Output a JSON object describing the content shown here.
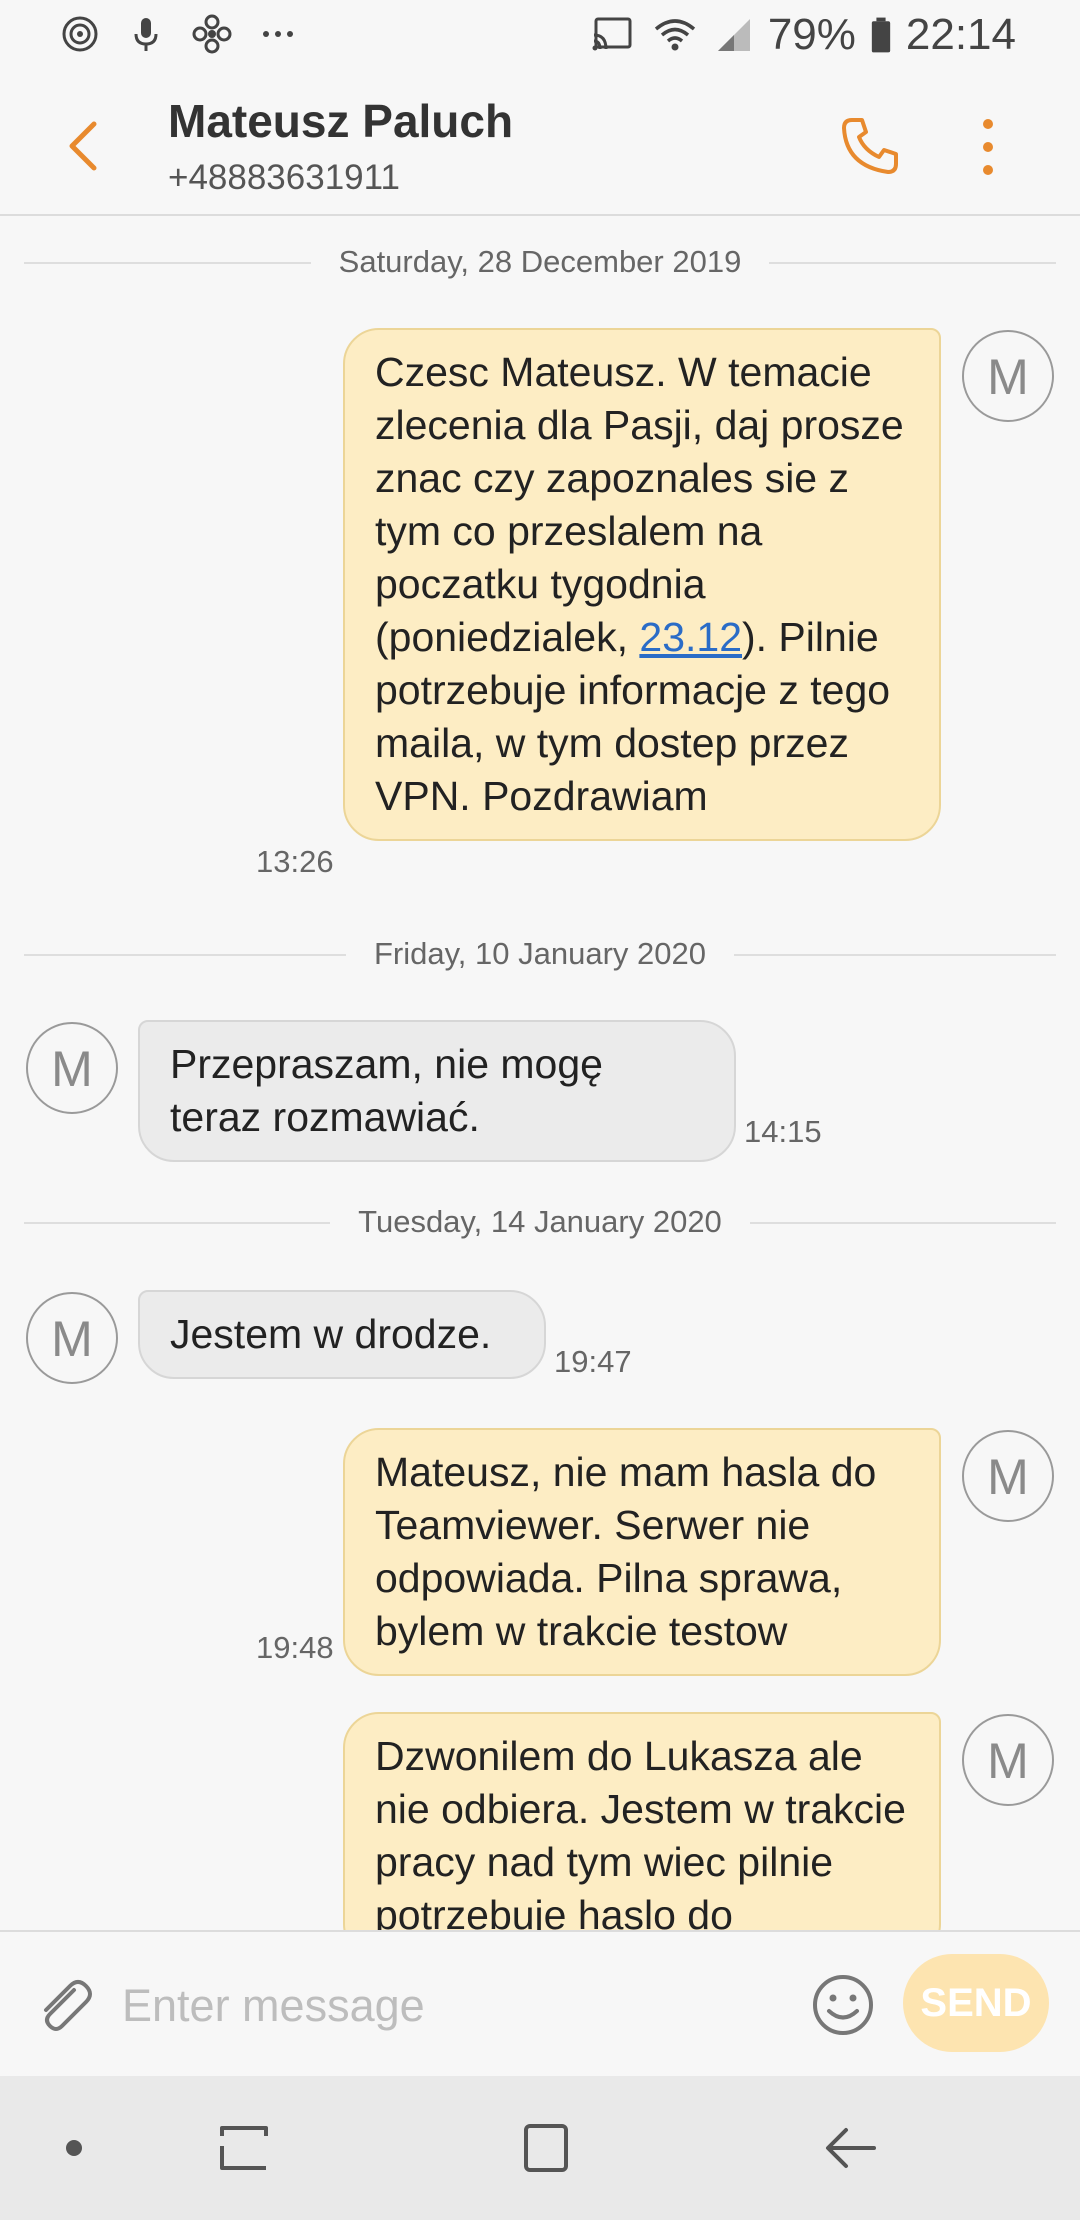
{
  "status_bar": {
    "battery": "79%",
    "time": "22:14",
    "left_icons": [
      "target-icon",
      "mic-icon",
      "fan-icon",
      "more-dots-icon"
    ],
    "right_icons": [
      "cast-icon",
      "wifi-icon",
      "signal-icon",
      "battery-icon"
    ]
  },
  "header": {
    "contact_name": "Mateusz Paluch",
    "contact_number": "+48883631911",
    "accent_color": "#e88a2e"
  },
  "conversation": {
    "dates": [
      "Saturday, 28 December 2019",
      "Friday, 10 January 2020",
      "Tuesday, 14 January 2020"
    ],
    "messages": [
      {
        "direction": "outgoing",
        "text_before_link": "Czesc Mateusz. W temacie zlecenia dla Pasji, daj prosze znac czy zapoznales sie z tym co przeslalem na poczatku tygodnia (poniedzialek, ",
        "link": "23.12",
        "text_after_link": "). Pilnie potrzebuje informacje z tego maila, w tym dostep przez VPN. Pozdrawiam",
        "time": "13:26",
        "avatar": "M"
      },
      {
        "direction": "incoming",
        "text": "Przepraszam, nie mogę teraz rozmawiać.",
        "time": "14:15",
        "avatar": "M"
      },
      {
        "direction": "incoming",
        "text": "Jestem w drodze.",
        "time": "19:47",
        "avatar": "M"
      },
      {
        "direction": "outgoing",
        "text": "Mateusz, nie mam hasla do Teamviewer. Serwer nie odpowiada. Pilna sprawa, bylem w trakcie testow",
        "time": "19:48",
        "avatar": "M"
      },
      {
        "direction": "outgoing",
        "text": "Dzwonilem do Lukasza ale nie odbiera. Jestem w trakcie pracy nad tym wiec pilnie potrzebuje haslo do",
        "avatar": "M"
      }
    ]
  },
  "input_bar": {
    "placeholder": "Enter message",
    "send_label": "SEND"
  },
  "nav_bar": {
    "icons": [
      "dot-icon",
      "recent-apps-icon",
      "home-icon",
      "back-icon"
    ]
  }
}
